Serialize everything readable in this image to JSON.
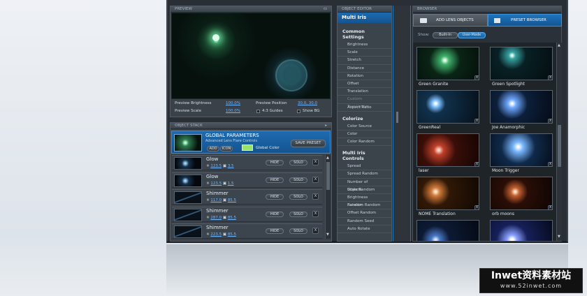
{
  "preview": {
    "title": "PREVIEW",
    "brightness_label": "Preview Brightness",
    "brightness": "100.0%",
    "position_label": "Preview Position",
    "position": "30.0, 30.0",
    "scale_label": "Preview Scale",
    "scale": "100.0%",
    "guides_label": "4:3 Guides",
    "showbg_label": "Show BG"
  },
  "stack": {
    "title": "OBJECT STACK",
    "global_title": "GLOBAL PARAMETERS",
    "global_sub": "Advanced Lens Flare Controls",
    "add": "ADD",
    "icon": "ICON",
    "global_color": "Global Color",
    "save_preset": "SAVE PRESET",
    "hide": "HIDE",
    "solo": "SOLO",
    "x": "X",
    "rows": [
      {
        "name": "Glow",
        "v1": "123.5",
        "v2": "3.5"
      },
      {
        "name": "Glow",
        "v1": "123.5",
        "v2": "1.5"
      },
      {
        "name": "Shimmer",
        "v1": "117.0",
        "v2": "85.5"
      },
      {
        "name": "Shimmer",
        "v1": "287.0",
        "v2": "85.5"
      },
      {
        "name": "Shimmer",
        "v1": "223.5",
        "v2": "85.5"
      }
    ]
  },
  "editor": {
    "title": "OBJECT EDITOR",
    "object": "Multi Iris",
    "sections": [
      {
        "title": "Common Settings",
        "items": [
          "Brightness",
          "Scale",
          "Stretch",
          "Distance",
          "Rotation",
          "Offset",
          "Translation",
          "Custom Translation",
          "Aspect Ratio"
        ],
        "disabled": [
          "Custom Translation"
        ]
      },
      {
        "title": "Colorize",
        "items": [
          "Color Source",
          "Color",
          "Color Random"
        ],
        "disabled": []
      },
      {
        "title": "Multi Iris Controls",
        "items": [
          "Spread",
          "Spread Random",
          "Number of Objects",
          "Scale Random",
          "Brightness Random",
          "Rotation Random",
          "Offset Random",
          "Random Seed",
          "Auto Rotate"
        ],
        "disabled": []
      }
    ]
  },
  "browser": {
    "title": "BROWSER",
    "tab_lens": "ADD LENS OBJECTS",
    "tab_preset": "PRESET BROWSER",
    "show_label": "Show:",
    "builtin": "Built-In",
    "usermade": "User-Made",
    "tiles": [
      "Green Granite",
      "Green Spotlight",
      "GreenReal",
      "Joe Anamorphic",
      "laser",
      "Moon Trigger",
      "NOME Translation",
      "orb moons",
      "",
      ""
    ]
  },
  "watermark": {
    "line1": "Inwet资料素材站",
    "line2": "www.52inwet.com"
  },
  "colors": {
    "accent": "#1a78c0",
    "global_color": "#9ce26a"
  }
}
